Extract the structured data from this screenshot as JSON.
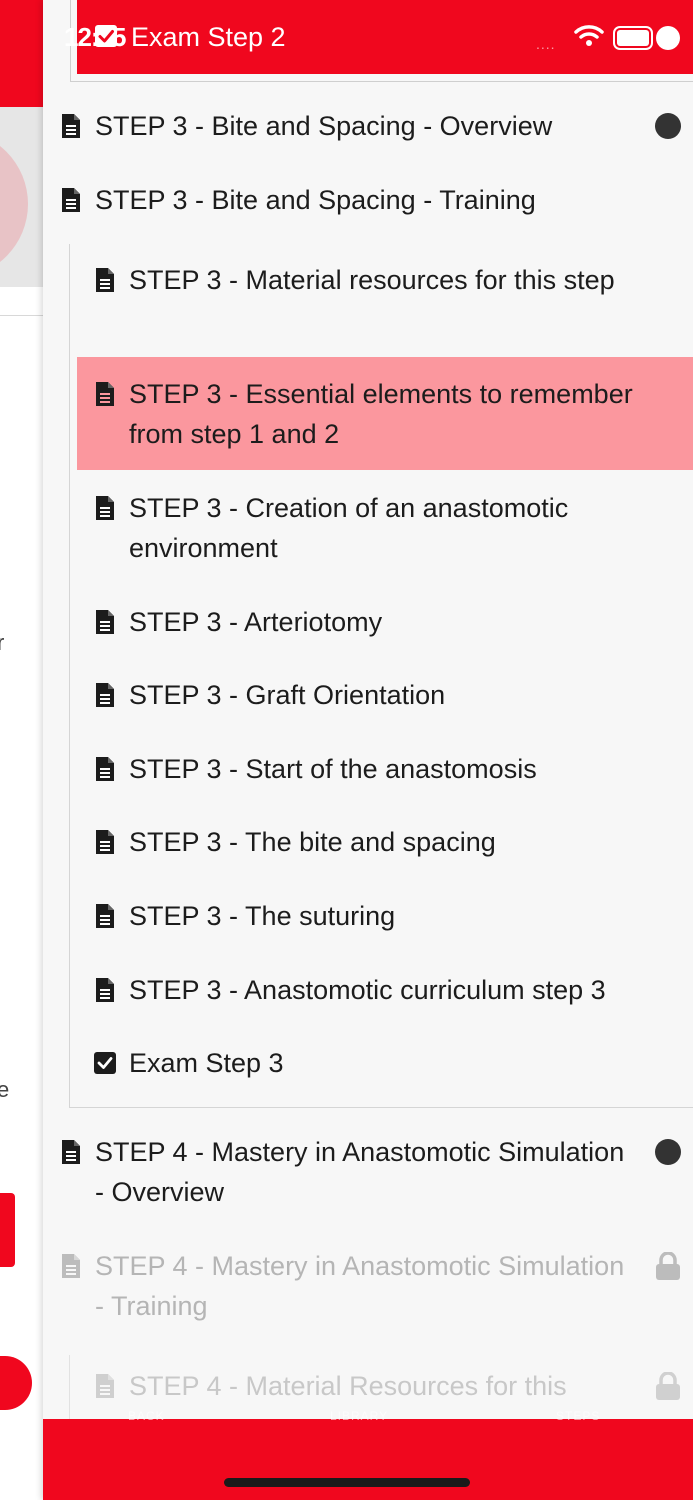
{
  "status_bar": {
    "time": "12:45",
    "signal": "....",
    "wifi_icon": "wifi-icon",
    "battery_icon": "battery-icon"
  },
  "header": {
    "title": "Exam Step 2",
    "icon": "checkbox-icon"
  },
  "background_page": {
    "letters": [
      "r",
      "e"
    ]
  },
  "course_items": [
    {
      "label": "STEP 3 - Bite and Spacing - Overview",
      "icon": "document-icon",
      "status": "dot"
    },
    {
      "label": "STEP 3 - Bite and Spacing - Training",
      "icon": "document-icon",
      "status": ""
    }
  ],
  "sub_items": [
    {
      "label": "STEP 3 - Material resources for this step",
      "icon": "document-icon"
    },
    {
      "label": "STEP 3 - Essential elements to remember from step 1 and 2",
      "icon": "document-icon",
      "active": true
    },
    {
      "label": "STEP 3 - Creation of an anastomotic environment",
      "icon": "document-icon"
    },
    {
      "label": "STEP 3 - Arteriotomy",
      "icon": "document-icon"
    },
    {
      "label": "STEP 3 - Graft Orientation",
      "icon": "document-icon"
    },
    {
      "label": "STEP 3 - Start of the anastomosis",
      "icon": "document-icon"
    },
    {
      "label": "STEP 3 - The bite and spacing",
      "icon": "document-icon"
    },
    {
      "label": "STEP 3 - The suturing",
      "icon": "document-icon"
    },
    {
      "label": "STEP 3 - Anastomotic curriculum step 3",
      "icon": "document-icon"
    },
    {
      "label": "Exam Step 3",
      "icon": "checkbox-icon"
    }
  ],
  "step4_items": [
    {
      "label": "STEP 4 - Mastery in Anastomotic Simulation - Overview",
      "icon": "document-icon",
      "status": "dot"
    },
    {
      "label": "STEP 4 - Mastery in Anastomotic Simulation - Training",
      "icon": "document-icon",
      "status": "lock",
      "locked": true
    },
    {
      "label": "STEP 4 - Material Resources for this",
      "icon": "document-icon",
      "status": "lock",
      "locked": true
    }
  ],
  "bottom_tabs": [
    "BACK",
    "LIBRARY",
    "STEPS"
  ],
  "colors": {
    "accent": "#f0071e",
    "highlight": "#fb979e",
    "drawer_bg": "#f7f7f7",
    "text": "#1c1c1c",
    "disabled_text": "#b5b5b5"
  }
}
